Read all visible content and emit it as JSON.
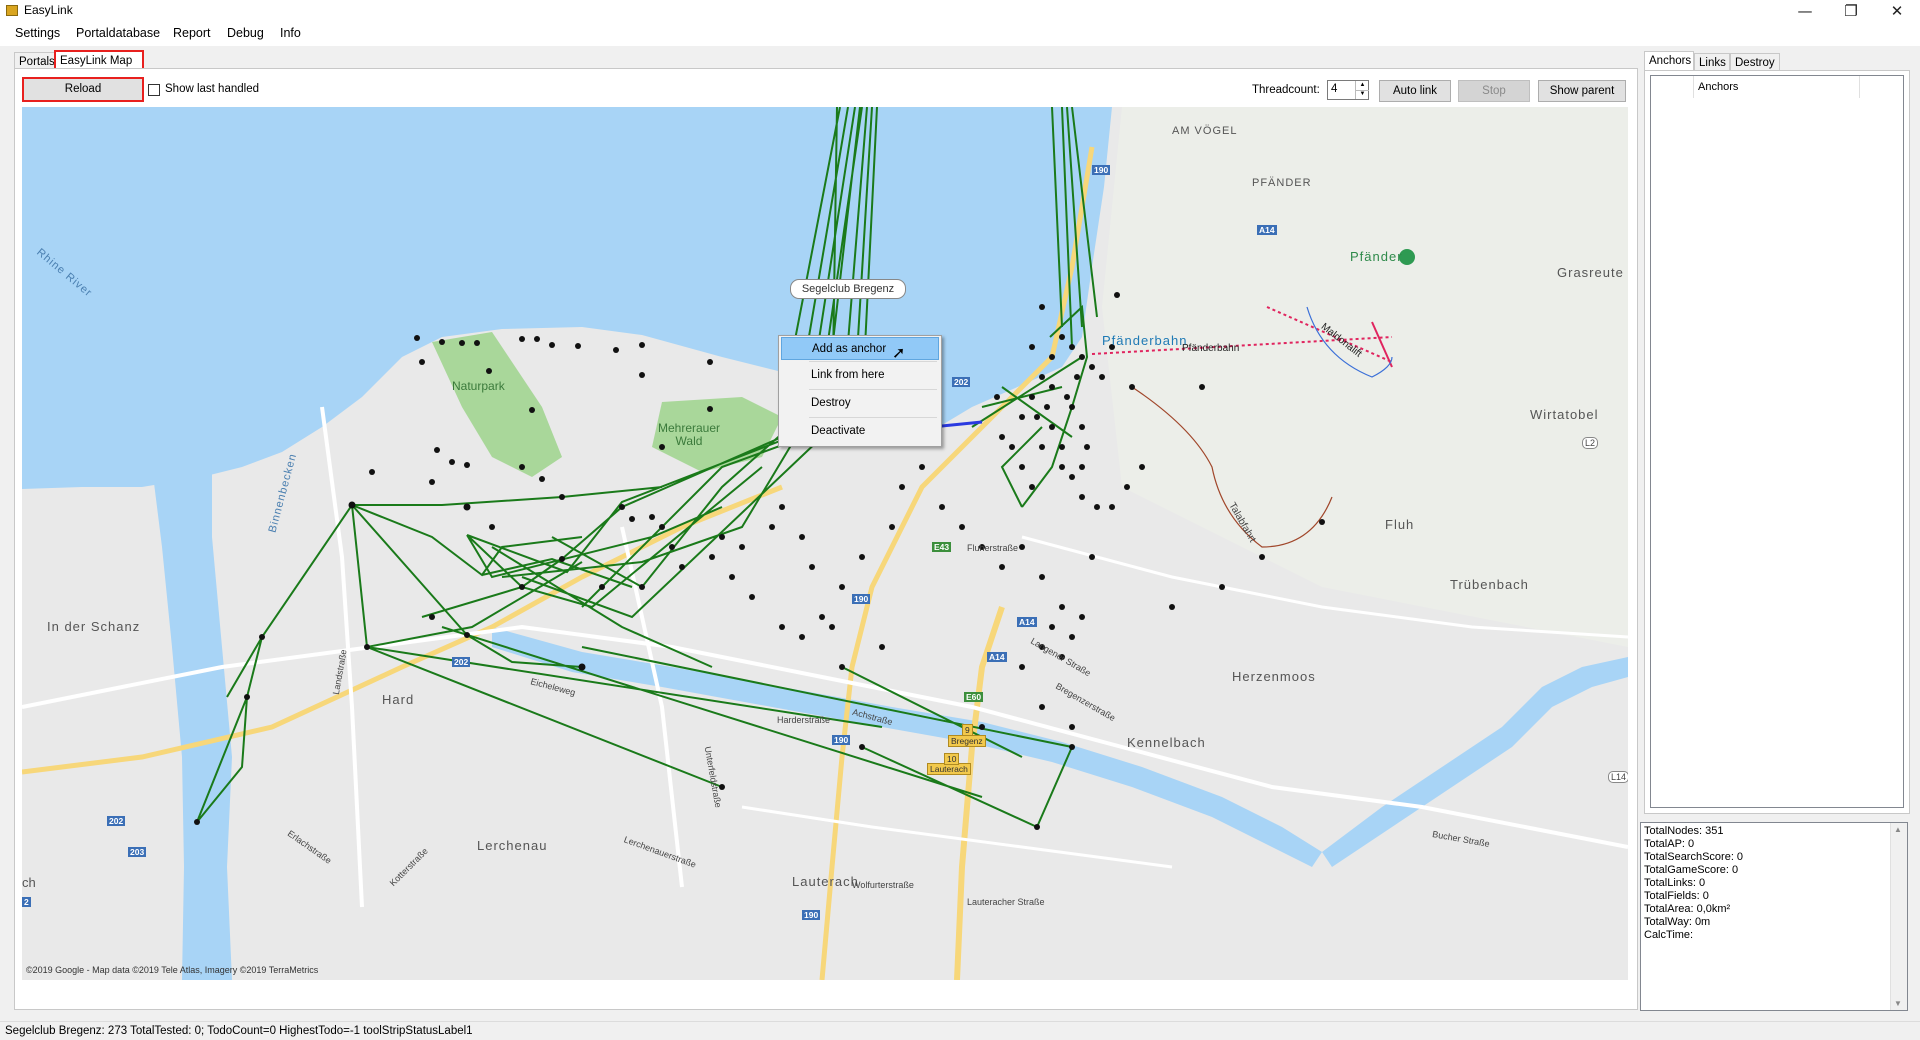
{
  "window": {
    "title": "EasyLink",
    "minimize": "—",
    "restore": "❐",
    "close": "✕"
  },
  "menu": [
    "Settings",
    "Portaldatabase",
    "Report",
    "Debug",
    "Info"
  ],
  "tabs": {
    "portals": "Portals",
    "map": "EasyLink Map"
  },
  "toolbar": {
    "reload": "Reload",
    "show_last_handled": "Show last handled",
    "threadcount_label": "Threadcount:",
    "threadcount_value": "4",
    "auto_link": "Auto link",
    "stop": "Stop",
    "show_parent": "Show parent"
  },
  "map": {
    "tooltip": "Segelclub Bregenz",
    "attribution": "©2019 Google - Map data ©2019 Tele Atlas, Imagery ©2019 TerraMetrics",
    "labels": {
      "am_vogel": "AM VÖGEL",
      "pfander_area": "PFÄNDER",
      "pfander": "Pfänder",
      "grasreute": "Grasreute",
      "pfanderbahn": "Pfänderbahn",
      "pfanderbahn_line": "Pfänderbahn",
      "naturpark": "Naturpark",
      "mehrerauer_wald": "Mehrerauer Wald",
      "rhine_river": "Rhine River",
      "binnenbecken": "Binnenbecken",
      "wirtatobel": "Wirtatobel",
      "fluh": "Fluh",
      "trubenbach": "Trübenbach",
      "in_der_schanz": "In der Schanz",
      "hard": "Hard",
      "herzenmoos": "Herzenmoos",
      "kennelbach": "Kennelbach",
      "lerchenau": "Lerchenau",
      "lauterach": "Lauterach",
      "bregenz_city": "Bregenz",
      "lauterach_tag": "Lauterach",
      "fluherstrasse": "Fluherstraße",
      "achstrasse": "Achstraße",
      "harderstrasse": "Harderstraße",
      "langener_strasse": "Langener Straße",
      "bregenzerstrasse": "Bregenzerstraße",
      "buchbrstrasse": "Bucher Straße",
      "maldonalift": "Maldonalift",
      "talabfahrt": "Talabfahrt",
      "landstrasse": "Landstraße",
      "eichelewag": "Eicheleweg",
      "wolfurterstrasse": "Wolfurterstraße",
      "lauteracher_strasse": "Lauteracher Straße",
      "erlachstrasse": "Erlachstraße",
      "kotterstrasse": "Kotterstraße",
      "lerchenauerstrasse": "Lerchenauerstraße",
      "unterfeldstrasse": "Unterfeldstraße",
      "ch_edge": "ch"
    },
    "shields": {
      "a190_top": "190",
      "a14_top": "A14",
      "a202_mid": "202",
      "a190_mid": "190",
      "e60": "E60",
      "a14_mid": "A14",
      "a190_low": "190",
      "a202_low": "202",
      "a203": "203",
      "a190_bot": "190",
      "l14": "L14",
      "e43": "E43",
      "a202_city": "202",
      "l2": "L2",
      "a2_edge": "2",
      "n9": "9",
      "n10": "10"
    }
  },
  "context_menu": [
    "Add as anchor",
    "Link from here",
    "Destroy",
    "Deactivate"
  ],
  "right_tabs": {
    "anchors": "Anchors",
    "links": "Links",
    "destroy": "Destroy"
  },
  "anchors_list": {
    "header": "Anchors"
  },
  "stats": [
    "TotalNodes: 351",
    "TotalAP: 0",
    "TotalSearchScore: 0",
    "TotalGameScore: 0",
    "TotalLinks: 0",
    "TotalFields: 0",
    "TotalArea: 0,0km²",
    "TotalWay: 0m",
    "CalcTime:"
  ],
  "status": "Segelclub Bregenz: 273  TotalTested: 0; TodoCount=0 HighestTodo=-1  toolStripStatusLabel1"
}
